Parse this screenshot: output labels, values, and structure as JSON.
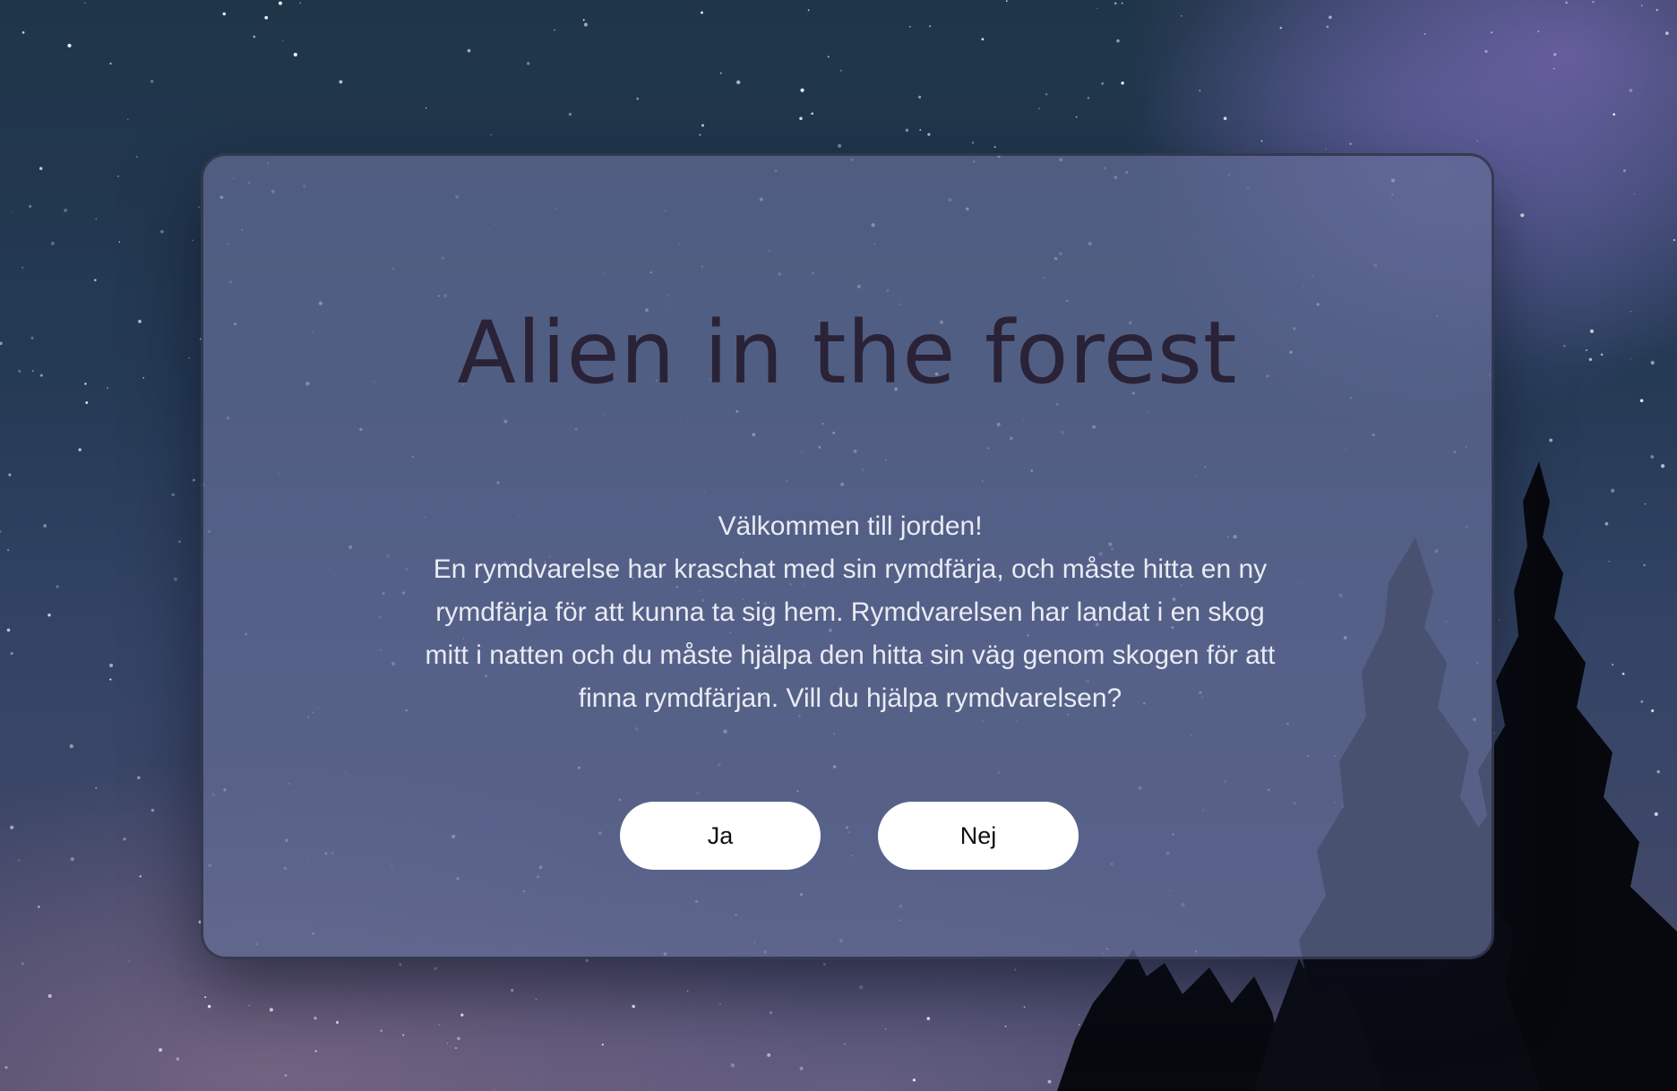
{
  "dialog": {
    "title": "Alien in the forest",
    "greeting": "Välkommen till jorden!",
    "story": "En rymdvarelse har kraschat med sin rymdfärja, och måste hitta en ny rymdfärja för att kunna ta sig hem. Rymdvarelsen har landat i en skog mitt i natten och du måste hjälpa den hitta sin väg genom skogen för att finna rymdfärjan. Vill du hjälpa rymdvarelsen?",
    "yes_label": "Ja",
    "no_label": "Nej"
  },
  "colors": {
    "title": "#2a2236",
    "body_text": "#e9ebf3",
    "button_bg": "#ffffff",
    "panel": "#626c96"
  }
}
